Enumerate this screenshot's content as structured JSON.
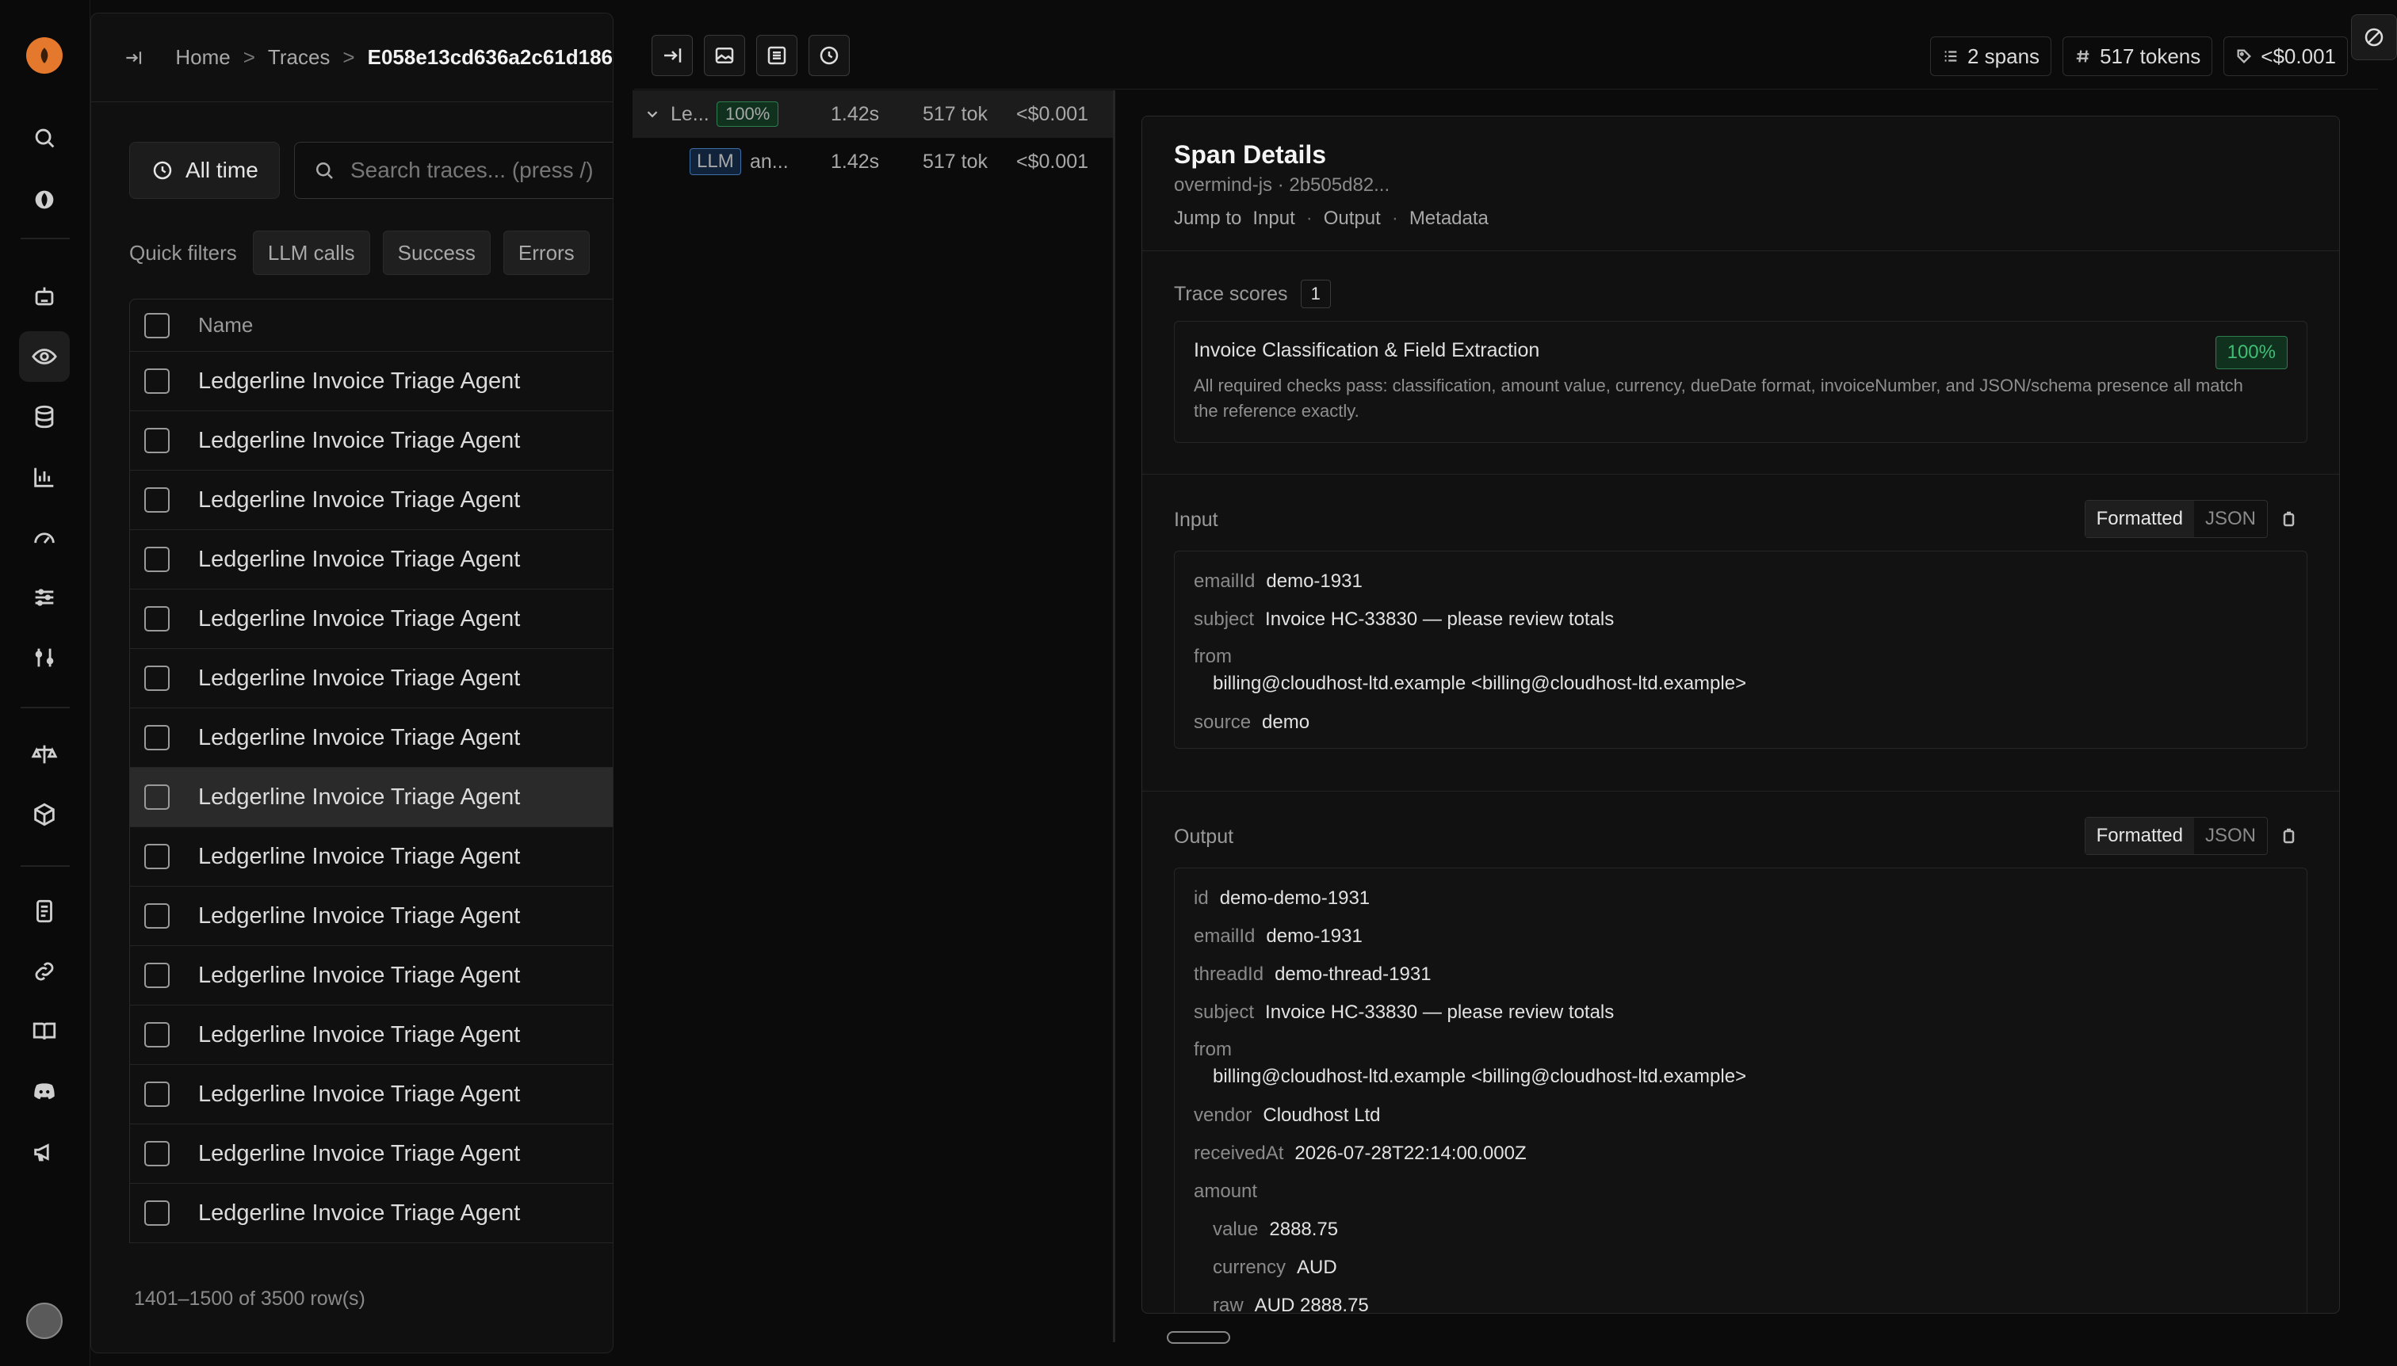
{
  "rail": {
    "icons": [
      "search-icon",
      "overmind-icon",
      "bot-icon",
      "eye-icon",
      "layers-icon",
      "chart-icon",
      "gauge-icon",
      "sliders-icon",
      "tools-icon",
      "scale-icon",
      "cube-icon",
      "docs-icon",
      "link-icon",
      "book-icon",
      "discord-icon",
      "megaphone-icon"
    ]
  },
  "breadcrumb": {
    "home": "Home",
    "traces": "Traces",
    "current": "E058e13cd636a2c61d186"
  },
  "filters": {
    "time_label": "All time",
    "search_placeholder": "Search traces... (press /)",
    "quick_label": "Quick filters",
    "chips": [
      "LLM calls",
      "Success",
      "Errors"
    ]
  },
  "table": {
    "header": "Name",
    "rows": [
      "Ledgerline Invoice Triage Agent",
      "Ledgerline Invoice Triage Agent",
      "Ledgerline Invoice Triage Agent",
      "Ledgerline Invoice Triage Agent",
      "Ledgerline Invoice Triage Agent",
      "Ledgerline Invoice Triage Agent",
      "Ledgerline Invoice Triage Agent",
      "Ledgerline Invoice Triage Agent",
      "Ledgerline Invoice Triage Agent",
      "Ledgerline Invoice Triage Agent",
      "Ledgerline Invoice Triage Agent",
      "Ledgerline Invoice Triage Agent",
      "Ledgerline Invoice Triage Agent",
      "Ledgerline Invoice Triage Agent",
      "Ledgerline Invoice Triage Agent"
    ],
    "selected_index": 7,
    "pager": "1401–1500 of 3500 row(s)"
  },
  "stats": {
    "spans": "2 spans",
    "tokens": "517 tokens",
    "cost": "<$0.001"
  },
  "spans": [
    {
      "name": "Le...",
      "badge": "100%",
      "duration": "1.42s",
      "tokens": "517 tok",
      "cost": "<$0.001"
    },
    {
      "name": "an...",
      "badge": "LLM",
      "duration": "1.42s",
      "tokens": "517 tok",
      "cost": "<$0.001"
    }
  ],
  "detail": {
    "title": "Span Details",
    "subtitle": "overmind-js · 2b505d82...",
    "jump_label": "Jump to",
    "jump_links": [
      "Input",
      "Output",
      "Metadata"
    ],
    "scores_label": "Trace scores",
    "scores_count": "1",
    "score": {
      "name": "Invoice Classification & Field Extraction",
      "pct": "100%",
      "desc": "All required checks pass: classification, amount value, currency, dueDate format, invoiceNumber, and JSON/schema presence all match the reference exactly."
    },
    "toggle_formatted": "Formatted",
    "toggle_json": "JSON",
    "input": {
      "label": "Input",
      "emailId_k": "emailId",
      "emailId_v": "demo-1931",
      "subject_k": "subject",
      "subject_v": "Invoice HC-33830 — please review totals",
      "from_k": "from",
      "from_v": "billing@cloudhost-ltd.example <billing@cloudhost-ltd.example>",
      "source_k": "source",
      "source_v": "demo"
    },
    "output": {
      "label": "Output",
      "id_k": "id",
      "id_v": "demo-demo-1931",
      "emailId_k": "emailId",
      "emailId_v": "demo-1931",
      "threadId_k": "threadId",
      "threadId_v": "demo-thread-1931",
      "subject_k": "subject",
      "subject_v": "Invoice HC-33830 — please review totals",
      "from_k": "from",
      "from_v": "billing@cloudhost-ltd.example <billing@cloudhost-ltd.example>",
      "vendor_k": "vendor",
      "vendor_v": "Cloudhost Ltd",
      "receivedAt_k": "receivedAt",
      "receivedAt_v": "2026-07-28T22:14:00.000Z",
      "amount_k": "amount",
      "value_k": "value",
      "value_v": "2888.75",
      "currency_k": "currency",
      "currency_v": "AUD",
      "raw_k": "raw",
      "raw_v": "AUD 2888.75"
    }
  }
}
